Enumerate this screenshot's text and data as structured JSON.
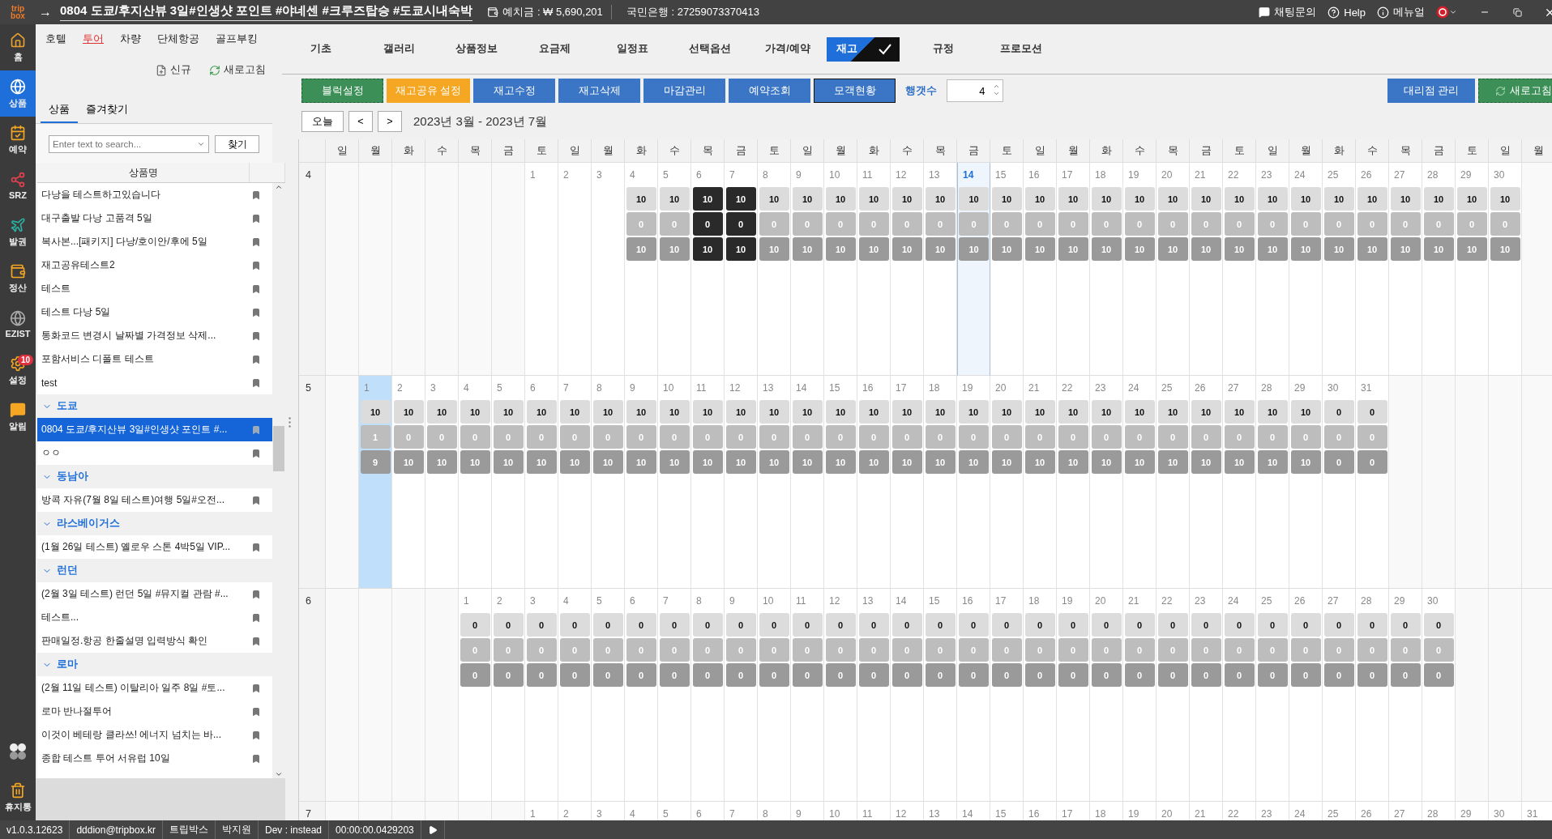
{
  "title_bar": {
    "logo": [
      "trip",
      "box"
    ],
    "arrow": "→",
    "title": "0804 도쿄/후지산뷰 3일#인생샷 포인트 #야네센 #크루즈탑승 #도쿄시내숙박",
    "deposit": "예치금 : ₩ 5,690,201",
    "bank": "국민은행 : 27259073370413",
    "links": [
      {
        "kind": "chat",
        "label": "채팅문의"
      },
      {
        "kind": "help",
        "label": "Help"
      },
      {
        "kind": "info",
        "label": "메뉴얼"
      }
    ]
  },
  "rail": [
    {
      "kind": "home",
      "label": "홈",
      "selected": false
    },
    {
      "kind": "product",
      "label": "상품",
      "selected": true
    },
    {
      "kind": "booking",
      "label": "예약",
      "selected": false
    },
    {
      "kind": "share",
      "label": "SRZ",
      "selected": false
    },
    {
      "kind": "plane",
      "label": "발권",
      "selected": false
    },
    {
      "kind": "wallet",
      "label": "정산",
      "selected": false
    },
    {
      "kind": "globe",
      "label": "EZIST",
      "selected": false
    },
    {
      "kind": "settings",
      "label": "설정",
      "selected": false,
      "badge": "10"
    },
    {
      "kind": "chat",
      "label": "알림",
      "selected": false
    }
  ],
  "rail_bottom": [
    {
      "kind": "apps"
    },
    {
      "kind": "trash",
      "label": "휴지통"
    }
  ],
  "category_nav": [
    {
      "label": "호텔",
      "selected": false
    },
    {
      "label": "투어",
      "selected": true
    },
    {
      "label": "차량",
      "selected": false
    },
    {
      "label": "단체항공",
      "selected": false
    },
    {
      "label": "골프부킹",
      "selected": false
    }
  ],
  "panel_actions": [
    {
      "kind": "new",
      "label": "신규"
    },
    {
      "kind": "refresh",
      "label": "새로고침"
    }
  ],
  "panel_tabs": [
    {
      "label": "상품",
      "selected": true
    },
    {
      "label": "즐겨찾기",
      "selected": false
    }
  ],
  "search": {
    "placeholder": "Enter text to search...",
    "button": "찾기"
  },
  "list": {
    "header": "상품명",
    "items": [
      {
        "kind": "item",
        "label": "다낭을 테스트하고있습니다",
        "selected": false
      },
      {
        "kind": "item",
        "label": "대구출발 다낭 고품격 5일",
        "selected": false
      },
      {
        "kind": "item",
        "label": "복사본...[패키지] 다낭/호이안/후에 5일",
        "selected": false
      },
      {
        "kind": "item",
        "label": "재고공유테스트2",
        "selected": false
      },
      {
        "kind": "item",
        "label": "테스트",
        "selected": false
      },
      {
        "kind": "item",
        "label": "테스트 다낭 5일",
        "selected": false
      },
      {
        "kind": "item",
        "label": "통화코드 변경시 날짜별 가격정보 삭제...",
        "selected": false
      },
      {
        "kind": "item",
        "label": "포함서비스 디폴트 테스트",
        "selected": false
      },
      {
        "kind": "item",
        "label": "test",
        "selected": false
      },
      {
        "kind": "group",
        "label": "도쿄",
        "expanded": true,
        "children": [
          {
            "kind": "item",
            "label": "0804 도쿄/후지산뷰 3일#인생샷 포인트 #...",
            "selected": true
          },
          {
            "kind": "item",
            "label": "ㅇㅇ",
            "selected": false
          }
        ]
      },
      {
        "kind": "group",
        "label": "동남아",
        "expanded": true,
        "children": [
          {
            "kind": "item",
            "label": "방콕 자유(7월 8일 테스트)여행 5일#오전...",
            "selected": false
          }
        ]
      },
      {
        "kind": "group",
        "label": "라스베이거스",
        "expanded": true,
        "children": [
          {
            "kind": "item",
            "label": "(1월 26일 테스트) 옐로우 스톤 4박5일 VIP...",
            "selected": false
          }
        ]
      },
      {
        "kind": "group",
        "label": "런던",
        "expanded": true,
        "children": [
          {
            "kind": "item",
            "label": "(2월 3일 테스트) 런던 5일 #뮤지컬 관람 #...",
            "selected": false
          },
          {
            "kind": "item",
            "label": "테스트...",
            "selected": false
          },
          {
            "kind": "item",
            "label": "판매일정.항공 한줄설명 입력방식 확인",
            "selected": false
          }
        ]
      },
      {
        "kind": "group",
        "label": "로마",
        "expanded": true,
        "children": [
          {
            "kind": "item",
            "label": "(2월 11일 테스트) 이탈리아 일주 8일 #토...",
            "selected": false
          },
          {
            "kind": "item",
            "label": "로마 반나절투어",
            "selected": false
          },
          {
            "kind": "item",
            "label": "이것이 베테랑 클라쓰! 에너지 넘치는 바...",
            "selected": false
          },
          {
            "kind": "item",
            "label": "종합 테스트 투어 서유럽 10일",
            "selected": false
          }
        ]
      }
    ]
  },
  "product_tabs": [
    {
      "label": "기초",
      "selected": false
    },
    {
      "label": "갤러리",
      "selected": false
    },
    {
      "label": "상품정보",
      "selected": false
    },
    {
      "label": "요금제",
      "selected": false
    },
    {
      "label": "일정표",
      "selected": false
    },
    {
      "label": "선택옵션",
      "selected": false
    },
    {
      "label": "가격/예약",
      "selected": false
    },
    {
      "label": "재고",
      "selected": true
    },
    {
      "label": "규정",
      "selected": false
    },
    {
      "label": "프로모션",
      "selected": false
    }
  ],
  "toolbar": {
    "buttons": [
      {
        "label": "블럭설정",
        "kind": "block"
      },
      {
        "label": "재고공유 설정",
        "kind": "share"
      },
      {
        "label": "재고수정",
        "kind": "action"
      },
      {
        "label": "재고삭제",
        "kind": "action"
      },
      {
        "label": "마감관리",
        "kind": "action"
      },
      {
        "label": "예약조회",
        "kind": "action"
      },
      {
        "label": "모객현황",
        "kind": "focused"
      }
    ],
    "row_count": {
      "label": "행갯수",
      "value": "4"
    },
    "right_buttons": [
      {
        "label": "대리점 관리",
        "kind": "action"
      },
      {
        "label": "새로고침",
        "kind": "refresh"
      }
    ]
  },
  "nav": {
    "today": "오늘",
    "prev": "<",
    "next": ">",
    "range": "2023년 3월 - 2023년 7월"
  },
  "calendar": {
    "weekdays": [
      "일",
      "월",
      "화",
      "수",
      "목",
      "금",
      "토",
      "일",
      "월",
      "화",
      "수",
      "목",
      "금",
      "토",
      "일",
      "월",
      "화",
      "수",
      "목",
      "금",
      "토",
      "일",
      "월",
      "화",
      "수",
      "목",
      "금",
      "토",
      "일",
      "월",
      "화",
      "수",
      "목",
      "금",
      "토",
      "일",
      "월"
    ],
    "months": [
      {
        "label": "4",
        "days": [
          {
            "kind": "blank"
          },
          {
            "kind": "blank"
          },
          {
            "kind": "blank"
          },
          {
            "kind": "blank"
          },
          {
            "kind": "blank"
          },
          {
            "kind": "blank"
          },
          {
            "kind": "day",
            "day": "1",
            "today": false,
            "selected": false
          },
          {
            "kind": "day",
            "day": "2",
            "today": false,
            "selected": false
          },
          {
            "kind": "day",
            "day": "3",
            "today": false,
            "selected": false
          },
          {
            "kind": "day",
            "day": "4",
            "stock": [
              "10",
              "0",
              "10"
            ],
            "closed": false,
            "today": false,
            "selected": false
          },
          {
            "kind": "day",
            "day": "5",
            "stock": [
              "10",
              "0",
              "10"
            ],
            "closed": false,
            "today": false,
            "selected": false
          },
          {
            "kind": "day",
            "day": "6",
            "stock": [
              "10",
              "0",
              "10"
            ],
            "closed": true,
            "today": false,
            "selected": false
          },
          {
            "kind": "day",
            "day": "7",
            "stock": [
              "10",
              "0",
              "10"
            ],
            "closed": true,
            "today": false,
            "selected": false
          },
          {
            "kind": "day",
            "day": "8",
            "stock": [
              "10",
              "0",
              "10"
            ],
            "closed": false,
            "today": false,
            "selected": false
          },
          {
            "kind": "day",
            "day": "9",
            "stock": [
              "10",
              "0",
              "10"
            ],
            "closed": false,
            "today": false,
            "selected": false
          },
          {
            "kind": "day",
            "day": "10",
            "stock": [
              "10",
              "0",
              "10"
            ],
            "closed": false,
            "today": false,
            "selected": false
          },
          {
            "kind": "day",
            "day": "11",
            "stock": [
              "10",
              "0",
              "10"
            ],
            "closed": false,
            "today": false,
            "selected": false
          },
          {
            "kind": "day",
            "day": "12",
            "stock": [
              "10",
              "0",
              "10"
            ],
            "closed": false,
            "today": false,
            "selected": false
          },
          {
            "kind": "day",
            "day": "13",
            "stock": [
              "10",
              "0",
              "10"
            ],
            "closed": false,
            "today": false,
            "selected": false
          },
          {
            "kind": "day",
            "day": "14",
            "stock": [
              "10",
              "0",
              "10"
            ],
            "closed": false,
            "today": true,
            "selected": false
          },
          {
            "kind": "day",
            "day": "15",
            "stock": [
              "10",
              "0",
              "10"
            ],
            "closed": false,
            "today": false,
            "selected": false
          },
          {
            "kind": "day",
            "day": "16",
            "stock": [
              "10",
              "0",
              "10"
            ],
            "closed": false,
            "today": false,
            "selected": false
          },
          {
            "kind": "day",
            "day": "17",
            "stock": [
              "10",
              "0",
              "10"
            ],
            "closed": false,
            "today": false,
            "selected": false
          },
          {
            "kind": "day",
            "day": "18",
            "stock": [
              "10",
              "0",
              "10"
            ],
            "closed": false,
            "today": false,
            "selected": false
          },
          {
            "kind": "day",
            "day": "19",
            "stock": [
              "10",
              "0",
              "10"
            ],
            "closed": false,
            "today": false,
            "selected": false
          },
          {
            "kind": "day",
            "day": "20",
            "stock": [
              "10",
              "0",
              "10"
            ],
            "closed": false,
            "today": false,
            "selected": false
          },
          {
            "kind": "day",
            "day": "21",
            "stock": [
              "10",
              "0",
              "10"
            ],
            "closed": false,
            "today": false,
            "selected": false
          },
          {
            "kind": "day",
            "day": "22",
            "stock": [
              "10",
              "0",
              "10"
            ],
            "closed": false,
            "today": false,
            "selected": false
          },
          {
            "kind": "day",
            "day": "23",
            "stock": [
              "10",
              "0",
              "10"
            ],
            "closed": false,
            "today": false,
            "selected": false
          },
          {
            "kind": "day",
            "day": "24",
            "stock": [
              "10",
              "0",
              "10"
            ],
            "closed": false,
            "today": false,
            "selected": false
          },
          {
            "kind": "day",
            "day": "25",
            "stock": [
              "10",
              "0",
              "10"
            ],
            "closed": false,
            "today": false,
            "selected": false
          },
          {
            "kind": "day",
            "day": "26",
            "stock": [
              "10",
              "0",
              "10"
            ],
            "closed": false,
            "today": false,
            "selected": false
          },
          {
            "kind": "day",
            "day": "27",
            "stock": [
              "10",
              "0",
              "10"
            ],
            "closed": false,
            "today": false,
            "selected": false
          },
          {
            "kind": "day",
            "day": "28",
            "stock": [
              "10",
              "0",
              "10"
            ],
            "closed": false,
            "today": false,
            "selected": false
          },
          {
            "kind": "day",
            "day": "29",
            "stock": [
              "10",
              "0",
              "10"
            ],
            "closed": false,
            "today": false,
            "selected": false
          },
          {
            "kind": "day",
            "day": "30",
            "stock": [
              "10",
              "0",
              "10"
            ],
            "closed": false,
            "today": false,
            "selected": false
          }
        ]
      },
      {
        "label": "5",
        "days": [
          {
            "kind": "blank"
          },
          {
            "kind": "day",
            "day": "1",
            "stock": [
              "10",
              "1",
              "9"
            ],
            "closed": false,
            "today": false,
            "selected": true
          },
          {
            "kind": "day",
            "day": "2",
            "stock": [
              "10",
              "0",
              "10"
            ],
            "closed": false,
            "today": false,
            "selected": false
          },
          {
            "kind": "day",
            "day": "3",
            "stock": [
              "10",
              "0",
              "10"
            ],
            "closed": false,
            "today": false,
            "selected": false
          },
          {
            "kind": "day",
            "day": "4",
            "stock": [
              "10",
              "0",
              "10"
            ],
            "closed": false,
            "today": false,
            "selected": false
          },
          {
            "kind": "day",
            "day": "5",
            "stock": [
              "10",
              "0",
              "10"
            ],
            "closed": false,
            "today": false,
            "selected": false
          },
          {
            "kind": "day",
            "day": "6",
            "stock": [
              "10",
              "0",
              "10"
            ],
            "closed": false,
            "today": false,
            "selected": false
          },
          {
            "kind": "day",
            "day": "7",
            "stock": [
              "10",
              "0",
              "10"
            ],
            "closed": false,
            "today": false,
            "selected": false
          },
          {
            "kind": "day",
            "day": "8",
            "stock": [
              "10",
              "0",
              "10"
            ],
            "closed": false,
            "today": false,
            "selected": false
          },
          {
            "kind": "day",
            "day": "9",
            "stock": [
              "10",
              "0",
              "10"
            ],
            "closed": false,
            "today": false,
            "selected": false
          },
          {
            "kind": "day",
            "day": "10",
            "stock": [
              "10",
              "0",
              "10"
            ],
            "closed": false,
            "today": false,
            "selected": false
          },
          {
            "kind": "day",
            "day": "11",
            "stock": [
              "10",
              "0",
              "10"
            ],
            "closed": false,
            "today": false,
            "selected": false
          },
          {
            "kind": "day",
            "day": "12",
            "stock": [
              "10",
              "0",
              "10"
            ],
            "closed": false,
            "today": false,
            "selected": false
          },
          {
            "kind": "day",
            "day": "13",
            "stock": [
              "10",
              "0",
              "10"
            ],
            "closed": false,
            "today": false,
            "selected": false
          },
          {
            "kind": "day",
            "day": "14",
            "stock": [
              "10",
              "0",
              "10"
            ],
            "closed": false,
            "today": false,
            "selected": false
          },
          {
            "kind": "day",
            "day": "15",
            "stock": [
              "10",
              "0",
              "10"
            ],
            "closed": false,
            "today": false,
            "selected": false
          },
          {
            "kind": "day",
            "day": "16",
            "stock": [
              "10",
              "0",
              "10"
            ],
            "closed": false,
            "today": false,
            "selected": false
          },
          {
            "kind": "day",
            "day": "17",
            "stock": [
              "10",
              "0",
              "10"
            ],
            "closed": false,
            "today": false,
            "selected": false
          },
          {
            "kind": "day",
            "day": "18",
            "stock": [
              "10",
              "0",
              "10"
            ],
            "closed": false,
            "today": false,
            "selected": false
          },
          {
            "kind": "day",
            "day": "19",
            "stock": [
              "10",
              "0",
              "10"
            ],
            "closed": false,
            "today": false,
            "selected": false
          },
          {
            "kind": "day",
            "day": "20",
            "stock": [
              "10",
              "0",
              "10"
            ],
            "closed": false,
            "today": false,
            "selected": false
          },
          {
            "kind": "day",
            "day": "21",
            "stock": [
              "10",
              "0",
              "10"
            ],
            "closed": false,
            "today": false,
            "selected": false
          },
          {
            "kind": "day",
            "day": "22",
            "stock": [
              "10",
              "0",
              "10"
            ],
            "closed": false,
            "today": false,
            "selected": false
          },
          {
            "kind": "day",
            "day": "23",
            "stock": [
              "10",
              "0",
              "10"
            ],
            "closed": false,
            "today": false,
            "selected": false
          },
          {
            "kind": "day",
            "day": "24",
            "stock": [
              "10",
              "0",
              "10"
            ],
            "closed": false,
            "today": false,
            "selected": false
          },
          {
            "kind": "day",
            "day": "25",
            "stock": [
              "10",
              "0",
              "10"
            ],
            "closed": false,
            "today": false,
            "selected": false
          },
          {
            "kind": "day",
            "day": "26",
            "stock": [
              "10",
              "0",
              "10"
            ],
            "closed": false,
            "today": false,
            "selected": false
          },
          {
            "kind": "day",
            "day": "27",
            "stock": [
              "10",
              "0",
              "10"
            ],
            "closed": false,
            "today": false,
            "selected": false
          },
          {
            "kind": "day",
            "day": "28",
            "stock": [
              "10",
              "0",
              "10"
            ],
            "closed": false,
            "today": false,
            "selected": false
          },
          {
            "kind": "day",
            "day": "29",
            "stock": [
              "10",
              "0",
              "10"
            ],
            "closed": false,
            "today": false,
            "selected": false
          },
          {
            "kind": "day",
            "day": "30",
            "stock": [
              "0",
              "0",
              "0"
            ],
            "closed": false,
            "today": false,
            "selected": false
          },
          {
            "kind": "day",
            "day": "31",
            "stock": [
              "0",
              "0",
              "0"
            ],
            "closed": false,
            "today": false,
            "selected": false
          }
        ]
      },
      {
        "label": "6",
        "days": [
          {
            "kind": "blank"
          },
          {
            "kind": "blank"
          },
          {
            "kind": "blank"
          },
          {
            "kind": "blank"
          },
          {
            "kind": "day",
            "day": "1",
            "stock": [
              "0",
              "0",
              "0"
            ],
            "closed": false,
            "today": false,
            "selected": false
          },
          {
            "kind": "day",
            "day": "2",
            "stock": [
              "0",
              "0",
              "0"
            ],
            "closed": false,
            "today": false,
            "selected": false
          },
          {
            "kind": "day",
            "day": "3",
            "stock": [
              "0",
              "0",
              "0"
            ],
            "closed": false,
            "today": false,
            "selected": false
          },
          {
            "kind": "day",
            "day": "4",
            "stock": [
              "0",
              "0",
              "0"
            ],
            "closed": false,
            "today": false,
            "selected": false
          },
          {
            "kind": "day",
            "day": "5",
            "stock": [
              "0",
              "0",
              "0"
            ],
            "closed": false,
            "today": false,
            "selected": false
          },
          {
            "kind": "day",
            "day": "6",
            "stock": [
              "0",
              "0",
              "0"
            ],
            "closed": false,
            "today": false,
            "selected": false
          },
          {
            "kind": "day",
            "day": "7",
            "stock": [
              "0",
              "0",
              "0"
            ],
            "closed": false,
            "today": false,
            "selected": false
          },
          {
            "kind": "day",
            "day": "8",
            "stock": [
              "0",
              "0",
              "0"
            ],
            "closed": false,
            "today": false,
            "selected": false
          },
          {
            "kind": "day",
            "day": "9",
            "stock": [
              "0",
              "0",
              "0"
            ],
            "closed": false,
            "today": false,
            "selected": false
          },
          {
            "kind": "day",
            "day": "10",
            "stock": [
              "0",
              "0",
              "0"
            ],
            "closed": false,
            "today": false,
            "selected": false
          },
          {
            "kind": "day",
            "day": "11",
            "stock": [
              "0",
              "0",
              "0"
            ],
            "closed": false,
            "today": false,
            "selected": false
          },
          {
            "kind": "day",
            "day": "12",
            "stock": [
              "0",
              "0",
              "0"
            ],
            "closed": false,
            "today": false,
            "selected": false
          },
          {
            "kind": "day",
            "day": "13",
            "stock": [
              "0",
              "0",
              "0"
            ],
            "closed": false,
            "today": false,
            "selected": false
          },
          {
            "kind": "day",
            "day": "14",
            "stock": [
              "0",
              "0",
              "0"
            ],
            "closed": false,
            "today": false,
            "selected": false
          },
          {
            "kind": "day",
            "day": "15",
            "stock": [
              "0",
              "0",
              "0"
            ],
            "closed": false,
            "today": false,
            "selected": false
          },
          {
            "kind": "day",
            "day": "16",
            "stock": [
              "0",
              "0",
              "0"
            ],
            "closed": false,
            "today": false,
            "selected": false
          },
          {
            "kind": "day",
            "day": "17",
            "stock": [
              "0",
              "0",
              "0"
            ],
            "closed": false,
            "today": false,
            "selected": false
          },
          {
            "kind": "day",
            "day": "18",
            "stock": [
              "0",
              "0",
              "0"
            ],
            "closed": false,
            "today": false,
            "selected": false
          },
          {
            "kind": "day",
            "day": "19",
            "stock": [
              "0",
              "0",
              "0"
            ],
            "closed": false,
            "today": false,
            "selected": false
          },
          {
            "kind": "day",
            "day": "20",
            "stock": [
              "0",
              "0",
              "0"
            ],
            "closed": false,
            "today": false,
            "selected": false
          },
          {
            "kind": "day",
            "day": "21",
            "stock": [
              "0",
              "0",
              "0"
            ],
            "closed": false,
            "today": false,
            "selected": false
          },
          {
            "kind": "day",
            "day": "22",
            "stock": [
              "0",
              "0",
              "0"
            ],
            "closed": false,
            "today": false,
            "selected": false
          },
          {
            "kind": "day",
            "day": "23",
            "stock": [
              "0",
              "0",
              "0"
            ],
            "closed": false,
            "today": false,
            "selected": false
          },
          {
            "kind": "day",
            "day": "24",
            "stock": [
              "0",
              "0",
              "0"
            ],
            "closed": false,
            "today": false,
            "selected": false
          },
          {
            "kind": "day",
            "day": "25",
            "stock": [
              "0",
              "0",
              "0"
            ],
            "closed": false,
            "today": false,
            "selected": false
          },
          {
            "kind": "day",
            "day": "26",
            "stock": [
              "0",
              "0",
              "0"
            ],
            "closed": false,
            "today": false,
            "selected": false
          },
          {
            "kind": "day",
            "day": "27",
            "stock": [
              "0",
              "0",
              "0"
            ],
            "closed": false,
            "today": false,
            "selected": false
          },
          {
            "kind": "day",
            "day": "28",
            "stock": [
              "0",
              "0",
              "0"
            ],
            "closed": false,
            "today": false,
            "selected": false
          },
          {
            "kind": "day",
            "day": "29",
            "stock": [
              "0",
              "0",
              "0"
            ],
            "closed": false,
            "today": false,
            "selected": false
          },
          {
            "kind": "day",
            "day": "30",
            "stock": [
              "0",
              "0",
              "0"
            ],
            "closed": false,
            "today": false,
            "selected": false
          }
        ]
      },
      {
        "label": "7",
        "days": [
          {
            "kind": "blank"
          },
          {
            "kind": "blank"
          },
          {
            "kind": "blank"
          },
          {
            "kind": "blank"
          },
          {
            "kind": "blank"
          },
          {
            "kind": "blank"
          },
          {
            "kind": "day",
            "day": "1",
            "today": false,
            "selected": false
          },
          {
            "kind": "day",
            "day": "2",
            "today": false,
            "selected": false
          },
          {
            "kind": "day",
            "day": "3",
            "today": false,
            "selected": false
          },
          {
            "kind": "day",
            "day": "4",
            "today": false,
            "selected": false
          },
          {
            "kind": "day",
            "day": "5",
            "today": false,
            "selected": false
          },
          {
            "kind": "day",
            "day": "6",
            "today": false,
            "selected": false
          },
          {
            "kind": "day",
            "day": "7",
            "today": false,
            "selected": false
          },
          {
            "kind": "day",
            "day": "8",
            "today": false,
            "selected": false
          },
          {
            "kind": "day",
            "day": "9",
            "today": false,
            "selected": false
          },
          {
            "kind": "day",
            "day": "10",
            "today": false,
            "selected": false
          },
          {
            "kind": "day",
            "day": "11",
            "today": false,
            "selected": false
          },
          {
            "kind": "day",
            "day": "12",
            "today": false,
            "selected": false
          },
          {
            "kind": "day",
            "day": "13",
            "today": false,
            "selected": false
          },
          {
            "kind": "day",
            "day": "14",
            "today": false,
            "selected": false
          },
          {
            "kind": "day",
            "day": "15",
            "today": false,
            "selected": false
          },
          {
            "kind": "day",
            "day": "16",
            "today": false,
            "selected": false
          },
          {
            "kind": "day",
            "day": "17",
            "today": false,
            "selected": false
          },
          {
            "kind": "day",
            "day": "18",
            "today": false,
            "selected": false
          },
          {
            "kind": "day",
            "day": "19",
            "today": false,
            "selected": false
          },
          {
            "kind": "day",
            "day": "20",
            "today": false,
            "selected": false
          },
          {
            "kind": "day",
            "day": "21",
            "today": false,
            "selected": false
          },
          {
            "kind": "day",
            "day": "22",
            "today": false,
            "selected": false
          },
          {
            "kind": "day",
            "day": "23",
            "today": false,
            "selected": false
          },
          {
            "kind": "day",
            "day": "24",
            "today": false,
            "selected": false
          },
          {
            "kind": "day",
            "day": "25",
            "today": false,
            "selected": false
          },
          {
            "kind": "day",
            "day": "26",
            "today": false,
            "selected": false
          },
          {
            "kind": "day",
            "day": "27",
            "today": false,
            "selected": false
          },
          {
            "kind": "day",
            "day": "28",
            "today": false,
            "selected": false
          },
          {
            "kind": "day",
            "day": "29",
            "today": false,
            "selected": false
          },
          {
            "kind": "day",
            "day": "30",
            "today": false,
            "selected": false
          },
          {
            "kind": "day",
            "day": "31",
            "today": false,
            "selected": false
          }
        ]
      }
    ]
  },
  "status_bar": [
    "v1.0.3.12623",
    "dddion@tripbox.kr",
    "트립박스",
    "박지원",
    "Dev : instead",
    "00:00:00.0429203"
  ]
}
